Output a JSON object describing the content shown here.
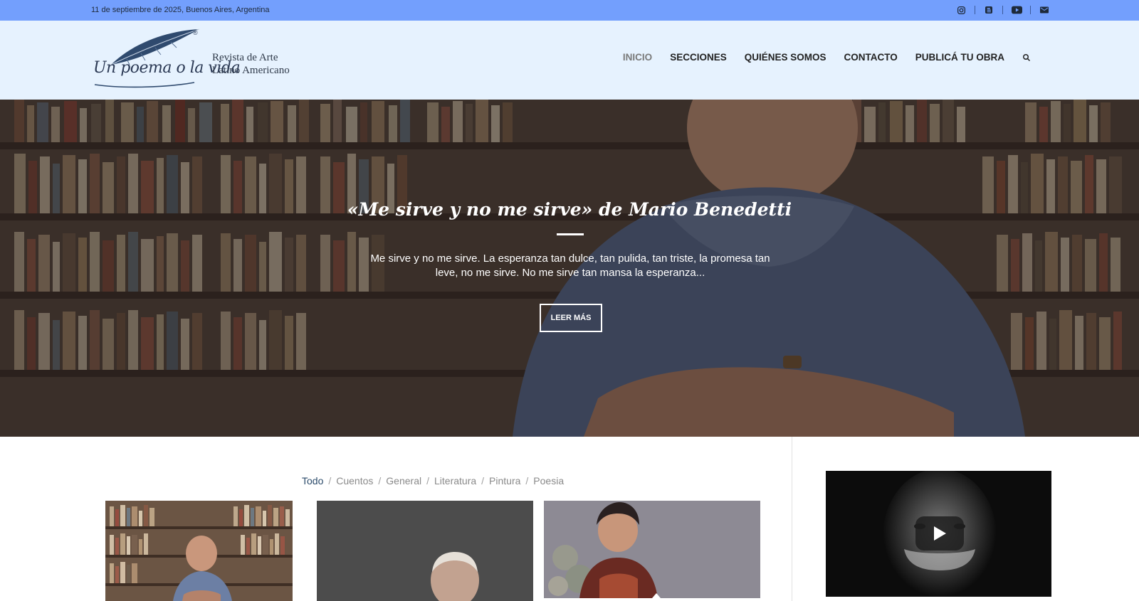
{
  "topbar": {
    "date": "11 de septiembre de 2025, Buenos Aires, Argentina",
    "social_icons": [
      "instagram-icon",
      "blog-icon",
      "youtube-icon",
      "mail-icon"
    ]
  },
  "logo": {
    "script": "Un poema o la vida",
    "registered": "®",
    "tagline_line1": "Revista de Arte",
    "tagline_line2": "Latino Americano"
  },
  "nav": {
    "items": [
      {
        "label": "INICIO",
        "active": true
      },
      {
        "label": "SECCIONES",
        "active": false
      },
      {
        "label": "QUIÉNES SOMOS",
        "active": false
      },
      {
        "label": "CONTACTO",
        "active": false
      },
      {
        "label": "PUBLICÁ TU OBRA",
        "active": false
      }
    ],
    "search_icon": "search-icon"
  },
  "hero": {
    "title": "«Me sirve y no me sirve» de Mario Benedetti",
    "excerpt": "Me sirve y no me sirve. La esperanza tan dulce, tan pulida, tan triste, la promesa tan leve, no me sirve. No me sirve tan mansa la esperanza...",
    "button": "LEER MÁS"
  },
  "filters": {
    "items": [
      "Todo",
      "Cuentos",
      "General",
      "Literatura",
      "Pintura",
      "Poesia"
    ],
    "active": "Todo",
    "separator": "/"
  },
  "colors": {
    "topbar": "#739ffd",
    "header": "#e6f2fe",
    "accent_filter": "#2a4a6a"
  },
  "video": {
    "play_icon": "play-icon"
  }
}
